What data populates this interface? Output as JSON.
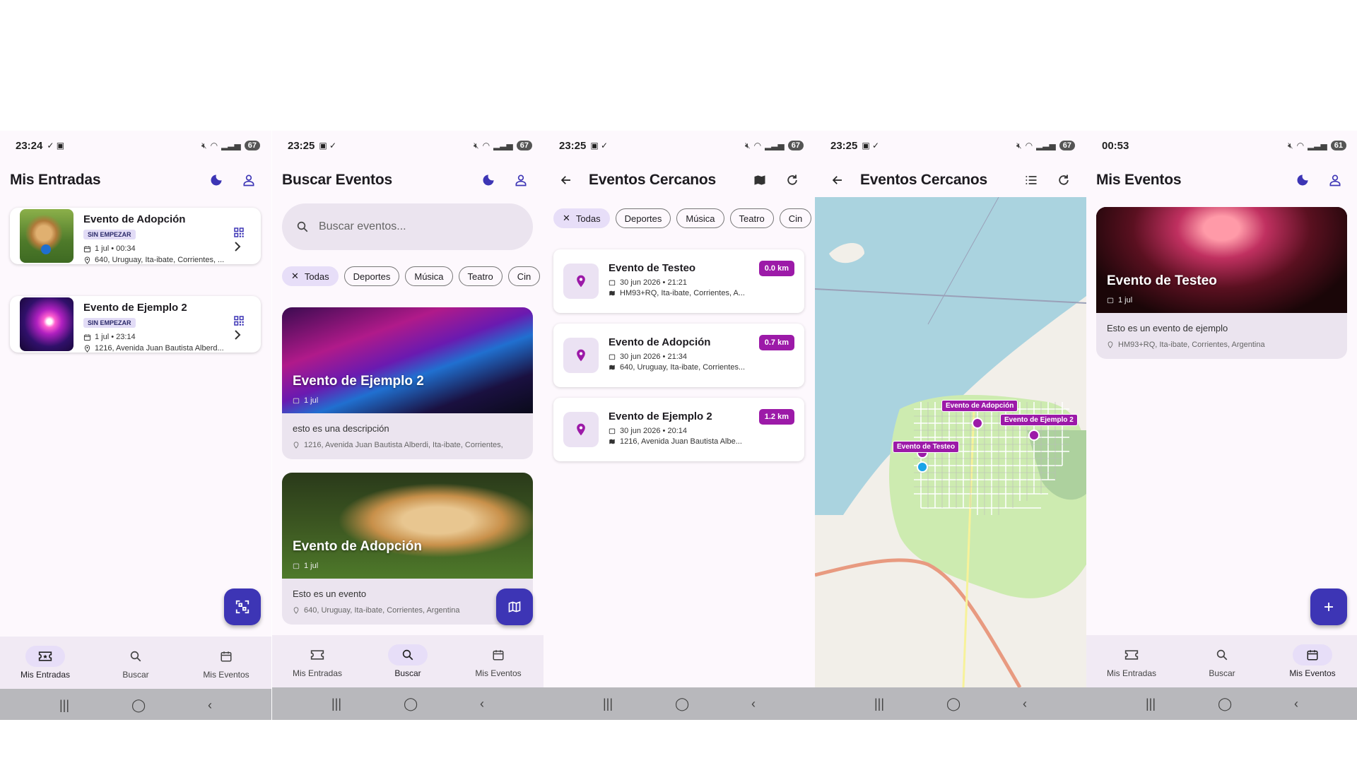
{
  "colors": {
    "accent": "#3d35b5",
    "km_badge": "#9c1aa8",
    "chip_selected": "#e7def8",
    "nav_bg": "#f1eaf4"
  },
  "screens": [
    {
      "status": {
        "time": "23:24",
        "battery": "67"
      },
      "title": "Mis Entradas",
      "tickets": [
        {
          "name": "Evento de Adopción",
          "badge": "SIN EMPEZAR",
          "date": "1 jul • 00:34",
          "location": "640, Uruguay, Ita-ibate, Corrientes, ..."
        },
        {
          "name": "Evento de Ejemplo 2",
          "badge": "SIN EMPEZAR",
          "date": "1 jul • 23:14",
          "location": "1216, Avenida Juan Bautista Alberd..."
        }
      ],
      "active_nav": "Mis Entradas"
    },
    {
      "status": {
        "time": "23:25",
        "battery": "67"
      },
      "title": "Buscar Eventos",
      "search_placeholder": "Buscar eventos...",
      "chips": [
        "Todas",
        "Deportes",
        "Música",
        "Teatro",
        "Cin"
      ],
      "events": [
        {
          "title": "Evento de Ejemplo 2",
          "date": "1 jul",
          "description": "esto es una descripción",
          "location": "1216, Avenida Juan Bautista Alberdi, Ita-ibate, Corrientes,"
        },
        {
          "title": "Evento de Adopción",
          "date": "1 jul",
          "description": "Esto es un evento",
          "location": "640, Uruguay, Ita-ibate, Corrientes, Argentina"
        }
      ],
      "active_nav": "Buscar"
    },
    {
      "status": {
        "time": "23:25",
        "battery": "67"
      },
      "title": "Eventos Cercanos",
      "chips": [
        "Todas",
        "Deportes",
        "Música",
        "Teatro",
        "Cin"
      ],
      "nearby": [
        {
          "name": "Evento de Testeo",
          "distance": "0.0 km",
          "date": "30 jun 2026 • 21:21",
          "address": "HM93+RQ, Ita-ibate, Corrientes, A..."
        },
        {
          "name": "Evento de Adopción",
          "distance": "0.7 km",
          "date": "30 jun 2026 • 21:34",
          "address": "640, Uruguay, Ita-ibate, Corrientes..."
        },
        {
          "name": "Evento de Ejemplo 2",
          "distance": "1.2 km",
          "date": "30 jun 2026 • 20:14",
          "address": "1216, Avenida Juan Bautista Albe..."
        }
      ]
    },
    {
      "status": {
        "time": "23:25",
        "battery": "67"
      },
      "title": "Eventos Cercanos",
      "map_labels": [
        "Evento de Adopción",
        "Evento de Ejemplo 2",
        "Evento de Testeo"
      ]
    },
    {
      "status": {
        "time": "00:53",
        "battery": "61"
      },
      "title": "Mis Eventos",
      "event": {
        "title": "Evento de Testeo",
        "date": "1 jul",
        "description": "Esto es un evento de ejemplo",
        "location": "HM93+RQ, Ita-ibate, Corrientes, Argentina"
      },
      "active_nav": "Mis Eventos"
    }
  ],
  "nav": {
    "entradas": "Mis Entradas",
    "buscar": "Buscar",
    "eventos": "Mis Eventos"
  }
}
